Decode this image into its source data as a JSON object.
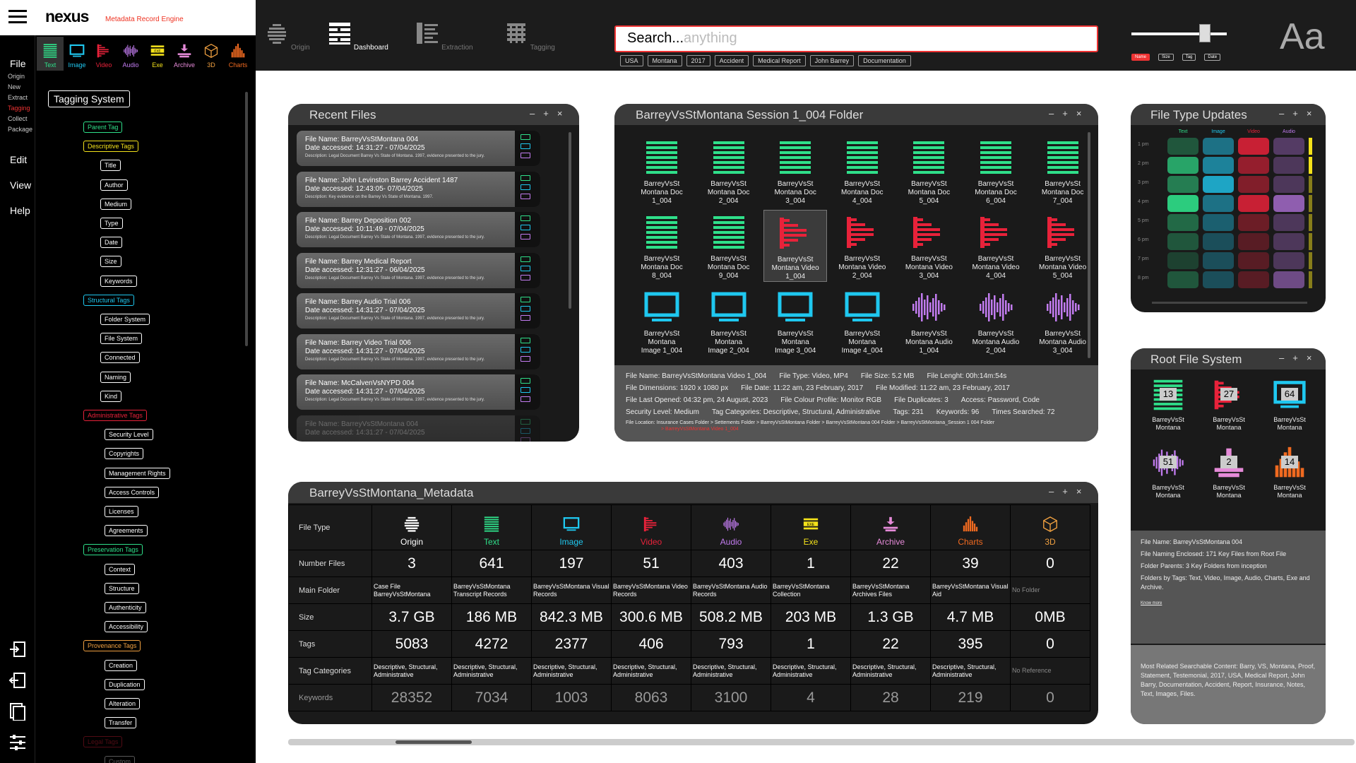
{
  "app": {
    "name": "nexus",
    "tagline": "Metadata Record Engine"
  },
  "media_types": [
    {
      "label": "Text",
      "color": "#2fe08a"
    },
    {
      "label": "Image",
      "color": "#1fc8f0"
    },
    {
      "label": "Video",
      "color": "#e8223a"
    },
    {
      "label": "Audio",
      "color": "#c27cf0"
    },
    {
      "label": "Exe",
      "color": "#f4e21a"
    },
    {
      "label": "Archive",
      "color": "#e58ad8"
    },
    {
      "label": "3D",
      "color": "#f0a040"
    },
    {
      "label": "Charts",
      "color": "#f06a20"
    }
  ],
  "menu": {
    "file": "File",
    "file_items": [
      "Origin",
      "New",
      "Extract",
      "Tagging",
      "Collect",
      "Package"
    ],
    "edit": "Edit",
    "view": "View",
    "help": "Help"
  },
  "tree": {
    "title": "Tagging System",
    "groups": [
      {
        "label": "Parent Tag",
        "color": "#2fe08a",
        "items": []
      },
      {
        "label": "Descriptive Tags",
        "color": "#f4e21a",
        "items": [
          "Title",
          "Author",
          "Medium",
          "Type",
          "Date",
          "Size",
          "Keywords"
        ]
      },
      {
        "label": "Structural Tags",
        "color": "#1fc8f0",
        "items": [
          "Folder System",
          "File System",
          "Connected",
          "Naming",
          "Kind"
        ]
      },
      {
        "label": "Administrative Tags",
        "color": "#e8223a",
        "items": [
          "Security Level",
          "Copyrights",
          "Management Rights",
          "Access Controls",
          "Licenses",
          "Agreements"
        ]
      },
      {
        "label": "Preservation Tags",
        "color": "#2fe08a",
        "items": [
          "Context",
          "Structure",
          "Authenticity",
          "Accessibility"
        ]
      },
      {
        "label": "Provenance Tags",
        "color": "#f0a040",
        "items": [
          "Creation",
          "Duplication",
          "Alteration",
          "Transfer"
        ]
      },
      {
        "label": "Legal Tags",
        "color": "#e8223a",
        "items": [
          "Custom"
        ]
      }
    ]
  },
  "nav": {
    "tabs": [
      "Origin",
      "Dashboard",
      "Extraction",
      "Tagging"
    ],
    "active": "Dashboard"
  },
  "search": {
    "text": "Search...",
    "placeholder": "anything",
    "chips": [
      "USA",
      "Montana",
      "2017",
      "Accident",
      "Medical Report",
      "John Barrey",
      "Documentation"
    ]
  },
  "filters": [
    "Name",
    "Size",
    "Tag",
    "Date"
  ],
  "font_toggle": "Aa",
  "recent": {
    "title": "Recent Files",
    "name_label": "File Name:",
    "date_label": "Date accessed:",
    "desc_label": "Description:",
    "items": [
      {
        "name": "BarreyVsStMontana 004",
        "date": "14:31:27 - 07/04/2025",
        "desc": "Legal Document Barrey Vs State of Montana. 1997, evidence presented to the jury."
      },
      {
        "name": "John Levinston Barrey Accident 1487",
        "date": "12:43:05- 07/04/2025",
        "desc": "Key evidence on the Barrey Vs State of Montana. 1997."
      },
      {
        "name": "Barrey Deposition 002",
        "date": "10:11:49 - 07/04/2025",
        "desc": "Legal Document Barrey Vs State of Montana. 1997, evidence presented to the jury."
      },
      {
        "name": "Barrey Medical Report",
        "date": "12:31:27 - 06/04/2025",
        "desc": "Legal Document Barrey Vs State of Montana. 1997, evidence presented to the jury."
      },
      {
        "name": "Barrey Audio Trial 006",
        "date": "14:31:27 - 07/04/2025",
        "desc": "Legal Document Barrey Vs State of Montana. 1997, evidence presented to the jury."
      },
      {
        "name": "Barrey Video Trial 006",
        "date": "14:31:27 - 07/04/2025",
        "desc": "Legal Document Barrey Vs State of Montana. 1997, evidence presented to the jury."
      },
      {
        "name": "McCalvenVsNYPD 004",
        "date": "14:31:27 - 07/04/2025",
        "desc": "Legal Document Barrey Vs State of Montana. 1997, evidence presented to the jury."
      },
      {
        "name": "BarreyVsStMontana 004",
        "date": "14:31:27 - 07/04/2025",
        "desc": ""
      }
    ]
  },
  "folder": {
    "title": "BarreyVsStMontana Session 1_004 Folder",
    "items": [
      {
        "l1": "BarreyVsSt",
        "l2": "Montana Doc",
        "l3": "1_004",
        "type": "text"
      },
      {
        "l1": "BarreyVsSt",
        "l2": "Montana Doc",
        "l3": "2_004",
        "type": "text"
      },
      {
        "l1": "BarreyVsSt",
        "l2": "Montana Doc",
        "l3": "3_004",
        "type": "text"
      },
      {
        "l1": "BarreyVsSt",
        "l2": "Montana Doc",
        "l3": "4_004",
        "type": "text"
      },
      {
        "l1": "BarreyVsSt",
        "l2": "Montana Doc",
        "l3": "5_004",
        "type": "text"
      },
      {
        "l1": "BarreyVsSt",
        "l2": "Montana Doc",
        "l3": "6_004",
        "type": "text"
      },
      {
        "l1": "BarreyVsSt",
        "l2": "Montana Doc",
        "l3": "7_004",
        "type": "text"
      },
      {
        "l1": "BarreyVsSt",
        "l2": "Montana Doc",
        "l3": "8_004",
        "type": "text"
      },
      {
        "l1": "BarreyVsSt",
        "l2": "Montana Doc",
        "l3": "9_004",
        "type": "text"
      },
      {
        "l1": "BarreyVsSt",
        "l2": "Montana Video",
        "l3": "1_004",
        "type": "video",
        "selected": true
      },
      {
        "l1": "BarreyVsSt",
        "l2": "Montana Video",
        "l3": "2_004",
        "type": "video"
      },
      {
        "l1": "BarreyVsSt",
        "l2": "Montana Video",
        "l3": "3_004",
        "type": "video"
      },
      {
        "l1": "BarreyVsSt",
        "l2": "Montana Video",
        "l3": "4_004",
        "type": "video"
      },
      {
        "l1": "BarreyVsSt",
        "l2": "Montana Video",
        "l3": "5_004",
        "type": "video"
      },
      {
        "l1": "BarreyVsSt",
        "l2": "Montana",
        "l3": "Image 1_004",
        "type": "image"
      },
      {
        "l1": "BarreyVsSt",
        "l2": "Montana",
        "l3": "Image 2_004",
        "type": "image"
      },
      {
        "l1": "BarreyVsSt",
        "l2": "Montana",
        "l3": "Image 3_004",
        "type": "image"
      },
      {
        "l1": "BarreyVsSt",
        "l2": "Montana",
        "l3": "Image 4_004",
        "type": "image"
      },
      {
        "l1": "BarreyVsSt",
        "l2": "Montana Audio",
        "l3": "1_004",
        "type": "audio"
      },
      {
        "l1": "BarreyVsSt",
        "l2": "Montana Audio",
        "l3": "2_004",
        "type": "audio"
      },
      {
        "l1": "BarreyVsSt",
        "l2": "Montana Audio",
        "l3": "3_004",
        "type": "audio"
      }
    ],
    "info": {
      "row1": [
        "File Name: BarreyVsStMontana Video 1_004",
        "File Type: Video, MP4",
        "File Size: 5.2 MB",
        "File Lenght: 00h:14m:54s"
      ],
      "row2": [
        "File Dimensions: 1920 x 1080 px",
        "File Date: 11:22 am, 23 February, 2017",
        "File Modified: 11:22 am, 23 February, 2017"
      ],
      "row3": [
        "File Last Opened: 04:32 pm, 24 August, 2023",
        "File Colour Profile: Monitor RGB",
        "File Duplicates: 3",
        "Access: Password, Code"
      ],
      "row4": [
        "Security Level: Medium",
        "Tag Categories: Descriptive, Structural, Administrative",
        "Tags: 231",
        "Keywords: 96",
        "Times Searched: 72"
      ],
      "location": "File Location: Insurance Cases Folder  >  Settements Folder  >  BarreyVsStMontana Folder  >  BarreyVsStMontana 004 Folder  >  BarreyVsStMontana_Session 1 004 Folder",
      "location_last": ">  BarreyVsStMontana Video 1_004"
    }
  },
  "updates": {
    "title": "File Type Updates",
    "cols": [
      "Text",
      "Image",
      "Video",
      "Audio"
    ],
    "rows": [
      "1 pm",
      "2 pm",
      "3 pm",
      "4 pm",
      "5 pm",
      "6 pm",
      "7 pm",
      "8 pm"
    ],
    "levels": [
      [
        0.3,
        0.5,
        0.85,
        0.35
      ],
      [
        0.7,
        0.6,
        0.6,
        0.3
      ],
      [
        0.5,
        0.8,
        0.5,
        0.3
      ],
      [
        0.9,
        0.5,
        0.85,
        0.7
      ],
      [
        0.4,
        0.4,
        0.4,
        0.3
      ],
      [
        0.3,
        0.3,
        0.3,
        0.3
      ],
      [
        0.2,
        0.3,
        0.3,
        0.3
      ],
      [
        0.3,
        0.3,
        0.3,
        0.5
      ]
    ]
  },
  "root": {
    "title": "Root File System",
    "items": [
      {
        "n": "13",
        "l1": "BarreyVsSt",
        "l2": "Montana",
        "type": "text"
      },
      {
        "n": "27",
        "l1": "BarreyVsSt",
        "l2": "Montana",
        "type": "video"
      },
      {
        "n": "64",
        "l1": "BarreyVsSt",
        "l2": "Montana",
        "type": "image"
      },
      {
        "n": "51",
        "l1": "BarreyVsSt",
        "l2": "Montana",
        "type": "audio"
      },
      {
        "n": "2",
        "l1": "BarreyVsSt",
        "l2": "Montana",
        "type": "archive"
      },
      {
        "n": "14",
        "l1": "BarreyVsSt",
        "l2": "Montana",
        "type": "charts"
      }
    ],
    "info": [
      "File Name: BarreyVsStMontana 004",
      "File Naming Enclosed: 171 Key Files from Root File",
      "Folder Parents: 3 Key Folders from inception",
      "Folders by Tags: Text, Video, Image, Audio, Charts, Exe and Archive."
    ],
    "know_more": "Know more",
    "related": "Most Related Searchable Content: Barry, VS, Montana, Proof, Statement, Testemonial, 2017, USA, Medical Report, John Barry, Documentation, Accident, Report, Insurance, Notes, Text, Images, Files."
  },
  "metadata": {
    "title": "BarreyVsStMontana_Metadata",
    "row_labels": [
      "File Type",
      "Number Files",
      "Main Folder",
      "Size",
      "Tags",
      "Tag Categories",
      "Keywords"
    ],
    "columns": [
      {
        "type": "Origin",
        "color": "#ffffff",
        "files": "3",
        "folder": "Case File BarreyVsStMontana",
        "size": "3.7 GB",
        "tags": "5083",
        "cats": "Descriptive, Structural, Administrative",
        "keywords": "28352"
      },
      {
        "type": "Text",
        "color": "#2fe08a",
        "files": "641",
        "folder": "BarreyVsStMontana Transcript Records",
        "size": "186 MB",
        "tags": "4272",
        "cats": "Descriptive, Structural, Administrative",
        "keywords": "7034"
      },
      {
        "type": "Image",
        "color": "#1fc8f0",
        "files": "197",
        "folder": "BarreyVsStMontana Visual Records",
        "size": "842.3 MB",
        "tags": "2377",
        "cats": "Descriptive, Structural, Administrative",
        "keywords": "1003"
      },
      {
        "type": "Video",
        "color": "#e8223a",
        "files": "51",
        "folder": "BarreyVsStMontana Video Records",
        "size": "300.6 MB",
        "tags": "406",
        "cats": "Descriptive, Structural, Administrative",
        "keywords": "8063"
      },
      {
        "type": "Audio",
        "color": "#c27cf0",
        "files": "403",
        "folder": "BarreyVsStMontana Audio Records",
        "size": "508.2 MB",
        "tags": "793",
        "cats": "Descriptive, Structural, Administrative",
        "keywords": "3100"
      },
      {
        "type": "Exe",
        "color": "#f4e21a",
        "files": "1",
        "folder": "BarreyVsStMontana Collection",
        "size": "203 MB",
        "tags": "1",
        "cats": "Descriptive, Structural, Administrative",
        "keywords": "4"
      },
      {
        "type": "Archive",
        "color": "#e58ad8",
        "files": "22",
        "folder": "BarreyVsStMontana Archives Files",
        "size": "1.3 GB",
        "tags": "22",
        "cats": "Descriptive, Structural, Administrative",
        "keywords": "28"
      },
      {
        "type": "Charts",
        "color": "#f06a20",
        "files": "39",
        "folder": "BarreyVsStMontana Visual Aid",
        "size": "4.7 MB",
        "tags": "395",
        "cats": "Descriptive, Structural, Administrative",
        "keywords": "219"
      },
      {
        "type": "3D",
        "color": "#f0a040",
        "files": "0",
        "folder": "No Folder",
        "size": "0MB",
        "tags": "0",
        "cats": "No Reference",
        "keywords": "0"
      }
    ]
  }
}
